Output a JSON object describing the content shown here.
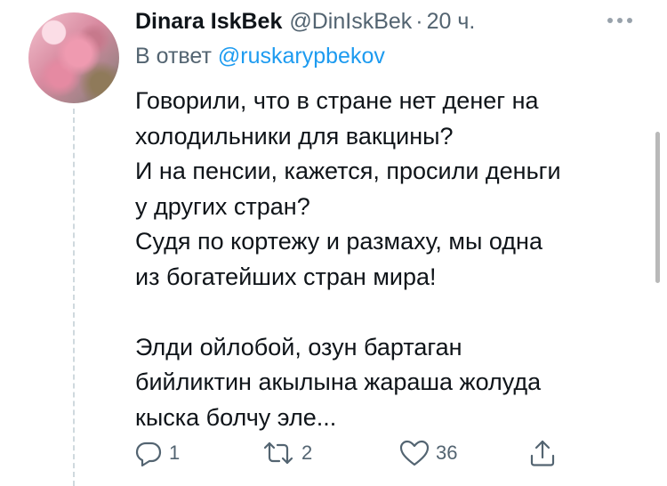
{
  "tweet": {
    "author_name": "Dinara IskBek",
    "author_handle": "@DinIskBek",
    "separator": "·",
    "time": "20 ч.",
    "reply_prefix": "В ответ",
    "reply_to": "@ruskarypbekov",
    "lines_ru": [
      "Говорили, что в стране нет денег на",
      "холодильники для вакцины?",
      "И на пенсии, кажется, просили деньги",
      "у других стран?",
      "Судя по кортежу и размаху, мы одна",
      "из богатейших стран мира!"
    ],
    "lines_ky": [
      "Элди ойлобой, озун бартаган",
      "бийликтин акылына жараша жолуда",
      "кыска болчу эле..."
    ]
  },
  "actions": {
    "reply_count": "1",
    "retweet_count": "2",
    "like_count": "36"
  },
  "icons": [
    "more-icon",
    "reply-icon",
    "retweet-icon",
    "like-icon",
    "share-icon"
  ],
  "colors": {
    "link": "#1d9bf0",
    "secondary": "#536471",
    "text": "#0f1419"
  }
}
